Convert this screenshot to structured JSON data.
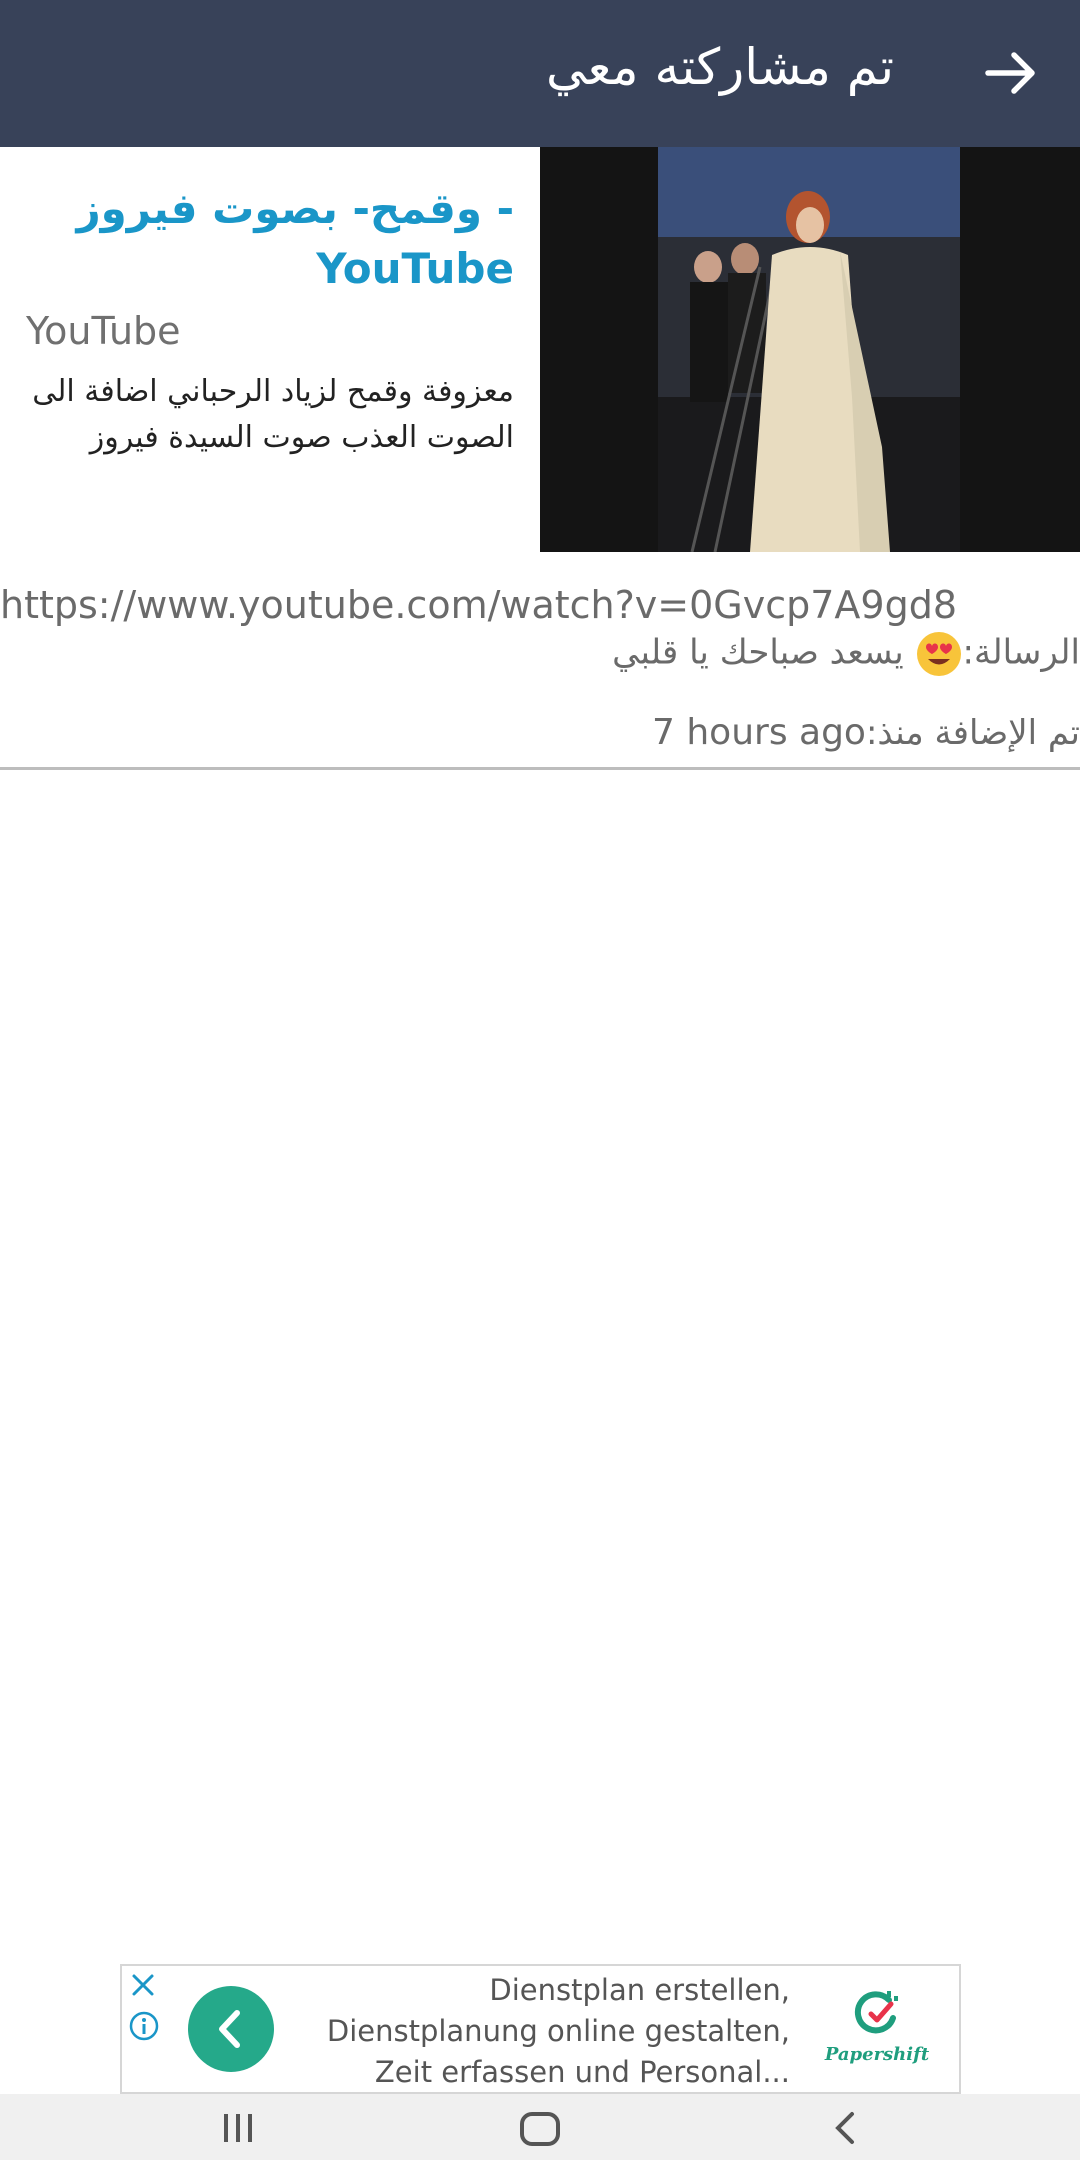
{
  "appbar": {
    "title": "تم مشاركته معي",
    "back_icon": "arrow-right-icon"
  },
  "preview": {
    "title_line1": "- وقمح- بصوت فيروز",
    "title_line2": "YouTube",
    "site": "YouTube",
    "description": "معزوفة وقمح لزياد الرحباني اضافة الى الصوت العذب صوت السيدة فيروز"
  },
  "details": {
    "url": "https://www.youtube.com/watch?v=0Gvcp7A9gd8",
    "message_label": "الرسالة:",
    "message_text": "يسعد صباحك يا قلبي",
    "message_emoji": "heart-eyes-emoji",
    "added_label": "تم الإضافة منذ:",
    "added_value": "7 hours ago"
  },
  "ad": {
    "text": "Dienstplan erstellen, Dienstplanung online gestalten, Zeit erfassen und Personal...",
    "brand": "Papershift",
    "accent_color": "#25a98a"
  },
  "colors": {
    "appbar": "#384259",
    "link_title": "#1a96c8"
  }
}
